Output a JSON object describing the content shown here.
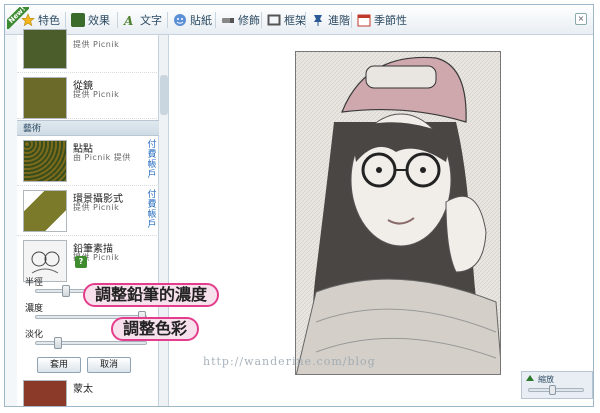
{
  "toolbar": {
    "new_badge": "New!",
    "tabs": [
      {
        "label": "特色",
        "icon": "star-icon",
        "color": "#f2b51d"
      },
      {
        "label": "效果",
        "icon": "effects-icon",
        "color": "#3a6b2a"
      },
      {
        "label": "文字",
        "icon": "text-icon",
        "color": "#4d7f2d"
      },
      {
        "label": "貼紙",
        "icon": "sticker-icon",
        "color": "#3b6fb6"
      },
      {
        "label": "修飾",
        "icon": "retouch-icon",
        "color": "#555555"
      },
      {
        "label": "框架",
        "icon": "frame-icon",
        "color": "#555555"
      },
      {
        "label": "進階",
        "icon": "pin-icon",
        "color": "#2b5a96"
      },
      {
        "label": "季節性",
        "icon": "calendar-icon",
        "color": "#c0392b"
      }
    ]
  },
  "effects": {
    "item1": {
      "name": "",
      "source": "提供 Picnik"
    },
    "item2": {
      "name": "從鏡",
      "source": "提供 Picnik"
    },
    "section_art": "藝術",
    "item3": {
      "name": "點點",
      "source": "由 Picnik 提供",
      "paid": "付費帳戶"
    },
    "item4": {
      "name": "環景攝影式",
      "source": "提供 Picnik",
      "paid": "付費帳戶"
    },
    "item5": {
      "name": "鉛筆素描",
      "source": "提供 Picnik",
      "help": "?"
    },
    "item6": {
      "name": "蒙太",
      "source": ""
    }
  },
  "controls": {
    "radius_label": "半徑",
    "intensity_label": "濃度",
    "fade_label": "淡化",
    "apply_label": "套用",
    "cancel_label": "取消",
    "radius_value": 0.25,
    "intensity_value": 1.0,
    "fade_value": 0.18
  },
  "canvas": {
    "zoom_label": "縮放",
    "close_icon": "x-icon"
  },
  "annotations": {
    "callout_pencil": "調整鉛筆的濃度",
    "callout_color": "調整色彩",
    "watermark": "http://wanderine.com/blog"
  }
}
